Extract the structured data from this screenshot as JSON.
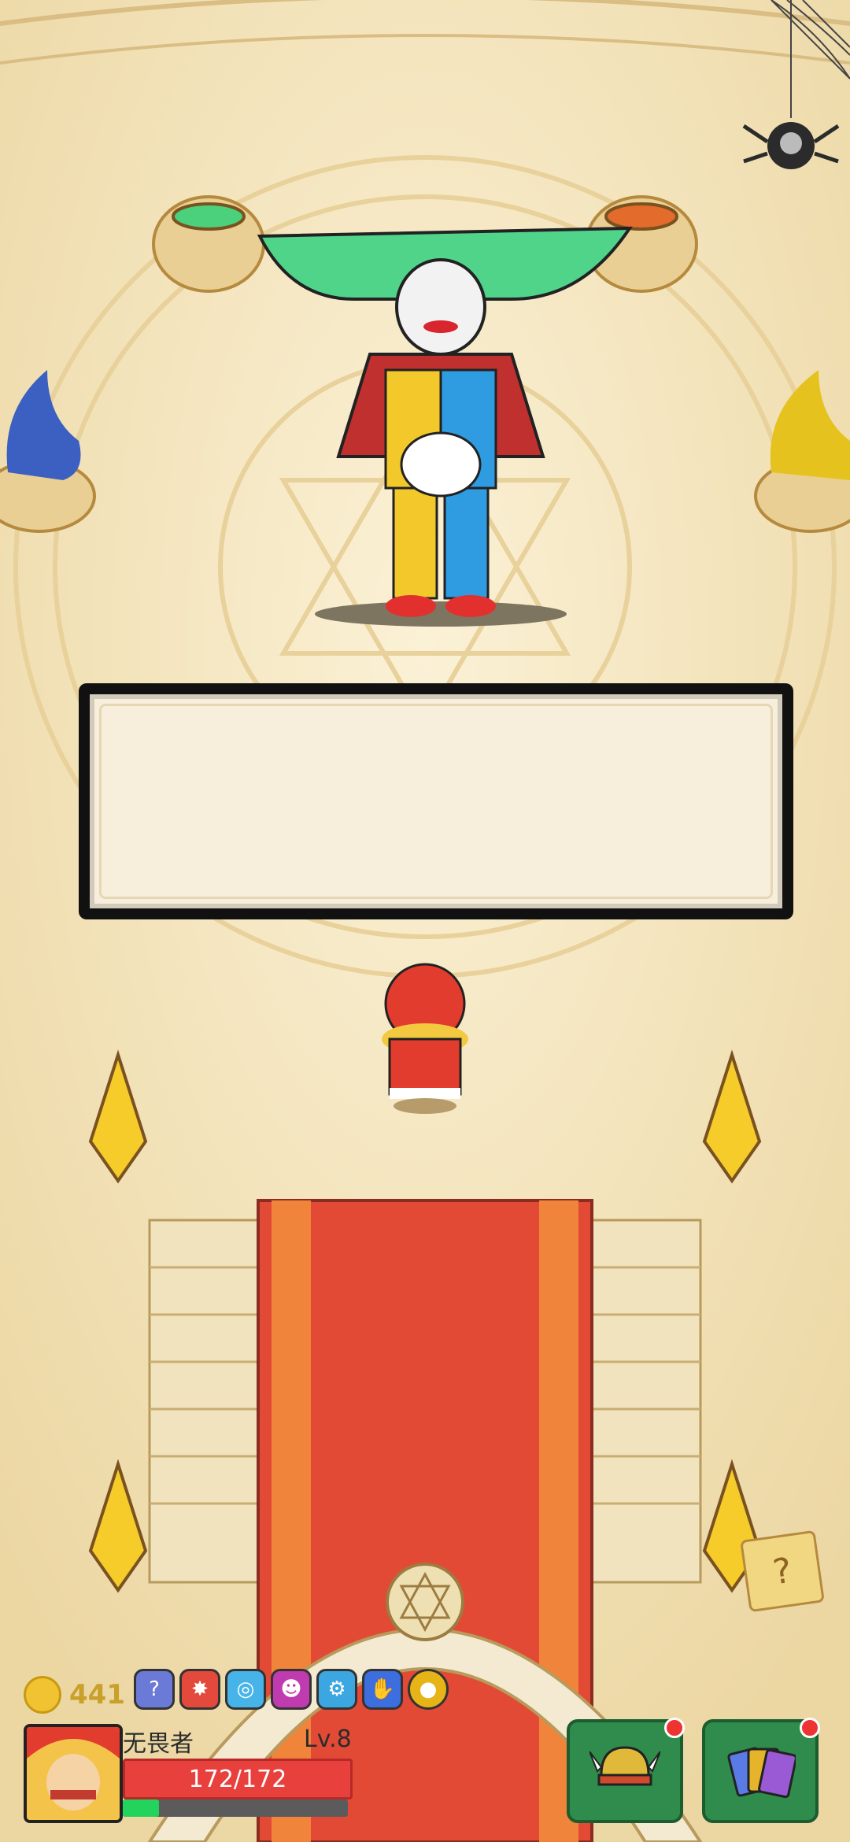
{
  "scene": {
    "boss_name": "",
    "dialog_text": ""
  },
  "hud": {
    "gold": "441",
    "items": [
      {
        "icon": "shield-question-icon",
        "color": "#6b7ad6"
      },
      {
        "icon": "explosion-icon",
        "color": "#e34a3b"
      },
      {
        "icon": "spiral-icon",
        "color": "#46b4e8"
      },
      {
        "icon": "demon-face-icon",
        "color": "#c03ab0"
      },
      {
        "icon": "gear-coin-icon",
        "color": "#3ba6e0"
      },
      {
        "icon": "hand-icon",
        "color": "#3c6ee0"
      },
      {
        "icon": "gold-coin-icon",
        "color": "#e6b416"
      }
    ],
    "player": {
      "name": "无畏者",
      "level": "Lv.8",
      "hp": "172/172",
      "xp_fraction": 0.16
    }
  },
  "colors": {
    "carpet": "#e24a36",
    "gold": "#c8a02a",
    "hp": "#e8403d",
    "xp": "#23d35b",
    "button": "#2f8c4c"
  }
}
